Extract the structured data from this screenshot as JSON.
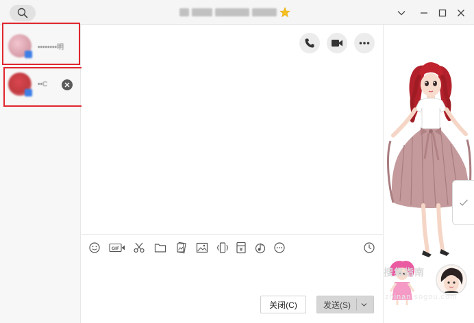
{
  "window": {
    "title": "••••••••",
    "controls": [
      "chevron-down-icon",
      "minimize-icon",
      "maximize-icon",
      "close-icon"
    ]
  },
  "sidebar": {
    "contacts": [
      {
        "name": "••••••••明",
        "selected": true
      },
      {
        "name": "••C",
        "selected": true,
        "has_close": true
      }
    ]
  },
  "chat_header": {
    "actions": [
      "phone-icon",
      "video-icon",
      "more-icon"
    ]
  },
  "toolbar": {
    "icons": [
      "emoji-icon",
      "gif-icon",
      "screenshot-scissors-icon",
      "folder-icon",
      "sticker-icon",
      "image-icon",
      "shake-window-icon",
      "red-packet-icon",
      "music-icon",
      "more-icon"
    ],
    "gif_label": "GIF",
    "history_icon": "clock-icon"
  },
  "buttons": {
    "close_label": "关闭(C)",
    "send_label": "发送(S)"
  },
  "show_panel": {
    "watermark_top": "搜集指南",
    "watermark_bottom": "zhinan.sogou.com"
  },
  "colors": {
    "highlight": "#e0252d",
    "title_bar": "#f5f5f5",
    "sidebar": "#f7f7f7",
    "send_button": "#d6d6d6"
  }
}
